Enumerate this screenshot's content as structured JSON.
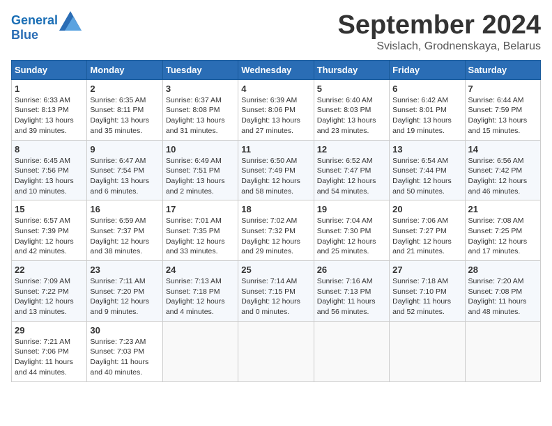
{
  "header": {
    "logo_line1": "General",
    "logo_line2": "Blue",
    "month_title": "September 2024",
    "location": "Svislach, Grodnenskaya, Belarus"
  },
  "weekdays": [
    "Sunday",
    "Monday",
    "Tuesday",
    "Wednesday",
    "Thursday",
    "Friday",
    "Saturday"
  ],
  "weeks": [
    [
      {
        "day": "1",
        "info": "Sunrise: 6:33 AM\nSunset: 8:13 PM\nDaylight: 13 hours\nand 39 minutes."
      },
      {
        "day": "2",
        "info": "Sunrise: 6:35 AM\nSunset: 8:11 PM\nDaylight: 13 hours\nand 35 minutes."
      },
      {
        "day": "3",
        "info": "Sunrise: 6:37 AM\nSunset: 8:08 PM\nDaylight: 13 hours\nand 31 minutes."
      },
      {
        "day": "4",
        "info": "Sunrise: 6:39 AM\nSunset: 8:06 PM\nDaylight: 13 hours\nand 27 minutes."
      },
      {
        "day": "5",
        "info": "Sunrise: 6:40 AM\nSunset: 8:03 PM\nDaylight: 13 hours\nand 23 minutes."
      },
      {
        "day": "6",
        "info": "Sunrise: 6:42 AM\nSunset: 8:01 PM\nDaylight: 13 hours\nand 19 minutes."
      },
      {
        "day": "7",
        "info": "Sunrise: 6:44 AM\nSunset: 7:59 PM\nDaylight: 13 hours\nand 15 minutes."
      }
    ],
    [
      {
        "day": "8",
        "info": "Sunrise: 6:45 AM\nSunset: 7:56 PM\nDaylight: 13 hours\nand 10 minutes."
      },
      {
        "day": "9",
        "info": "Sunrise: 6:47 AM\nSunset: 7:54 PM\nDaylight: 13 hours\nand 6 minutes."
      },
      {
        "day": "10",
        "info": "Sunrise: 6:49 AM\nSunset: 7:51 PM\nDaylight: 13 hours\nand 2 minutes."
      },
      {
        "day": "11",
        "info": "Sunrise: 6:50 AM\nSunset: 7:49 PM\nDaylight: 12 hours\nand 58 minutes."
      },
      {
        "day": "12",
        "info": "Sunrise: 6:52 AM\nSunset: 7:47 PM\nDaylight: 12 hours\nand 54 minutes."
      },
      {
        "day": "13",
        "info": "Sunrise: 6:54 AM\nSunset: 7:44 PM\nDaylight: 12 hours\nand 50 minutes."
      },
      {
        "day": "14",
        "info": "Sunrise: 6:56 AM\nSunset: 7:42 PM\nDaylight: 12 hours\nand 46 minutes."
      }
    ],
    [
      {
        "day": "15",
        "info": "Sunrise: 6:57 AM\nSunset: 7:39 PM\nDaylight: 12 hours\nand 42 minutes."
      },
      {
        "day": "16",
        "info": "Sunrise: 6:59 AM\nSunset: 7:37 PM\nDaylight: 12 hours\nand 38 minutes."
      },
      {
        "day": "17",
        "info": "Sunrise: 7:01 AM\nSunset: 7:35 PM\nDaylight: 12 hours\nand 33 minutes."
      },
      {
        "day": "18",
        "info": "Sunrise: 7:02 AM\nSunset: 7:32 PM\nDaylight: 12 hours\nand 29 minutes."
      },
      {
        "day": "19",
        "info": "Sunrise: 7:04 AM\nSunset: 7:30 PM\nDaylight: 12 hours\nand 25 minutes."
      },
      {
        "day": "20",
        "info": "Sunrise: 7:06 AM\nSunset: 7:27 PM\nDaylight: 12 hours\nand 21 minutes."
      },
      {
        "day": "21",
        "info": "Sunrise: 7:08 AM\nSunset: 7:25 PM\nDaylight: 12 hours\nand 17 minutes."
      }
    ],
    [
      {
        "day": "22",
        "info": "Sunrise: 7:09 AM\nSunset: 7:22 PM\nDaylight: 12 hours\nand 13 minutes."
      },
      {
        "day": "23",
        "info": "Sunrise: 7:11 AM\nSunset: 7:20 PM\nDaylight: 12 hours\nand 9 minutes."
      },
      {
        "day": "24",
        "info": "Sunrise: 7:13 AM\nSunset: 7:18 PM\nDaylight: 12 hours\nand 4 minutes."
      },
      {
        "day": "25",
        "info": "Sunrise: 7:14 AM\nSunset: 7:15 PM\nDaylight: 12 hours\nand 0 minutes."
      },
      {
        "day": "26",
        "info": "Sunrise: 7:16 AM\nSunset: 7:13 PM\nDaylight: 11 hours\nand 56 minutes."
      },
      {
        "day": "27",
        "info": "Sunrise: 7:18 AM\nSunset: 7:10 PM\nDaylight: 11 hours\nand 52 minutes."
      },
      {
        "day": "28",
        "info": "Sunrise: 7:20 AM\nSunset: 7:08 PM\nDaylight: 11 hours\nand 48 minutes."
      }
    ],
    [
      {
        "day": "29",
        "info": "Sunrise: 7:21 AM\nSunset: 7:06 PM\nDaylight: 11 hours\nand 44 minutes."
      },
      {
        "day": "30",
        "info": "Sunrise: 7:23 AM\nSunset: 7:03 PM\nDaylight: 11 hours\nand 40 minutes."
      },
      null,
      null,
      null,
      null,
      null
    ]
  ]
}
